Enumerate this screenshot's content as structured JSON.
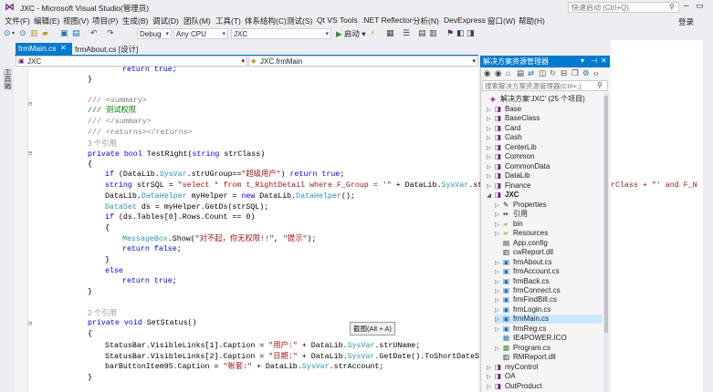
{
  "window": {
    "title": "JXC - Microsoft Visual Studio(管理员)",
    "quick_launch_placeholder": "快速启动 (Ctrl+Q)"
  },
  "menu": [
    "文件(F)",
    "编辑(E)",
    "视图(V)",
    "项目(P)",
    "生成(B)",
    "调试(D)",
    "团队(M)",
    "工具(T)",
    "体系结构(C)",
    "测试(S)",
    "Qt VS Tools",
    ".NET Reflector",
    "分析(N)",
    "DevExpress",
    "窗口(W)",
    "帮助(H)"
  ],
  "login": "登录",
  "toolbar": {
    "config": "Debug",
    "platform": "Any CPU",
    "project": "JXC",
    "start": "启动"
  },
  "tabs": [
    {
      "label": "frmMain.cs",
      "active": true
    },
    {
      "label": "frmAbout.cs [设计]",
      "active": false
    }
  ],
  "navbar": {
    "project": "JXC",
    "class": "JXC.frmMain"
  },
  "toolbox_label": "工具箱",
  "code": {
    "l1": "return true;",
    "l2": "}",
    "l3": "/// <summary>",
    "l4": "/// 测试权限",
    "l5": "/// </summary>",
    "l6": "/// <returns></returns>",
    "ref1": "3 个引用",
    "l7a": "private bool ",
    "l7b": "TestRight(",
    "l7c": "string",
    "l7d": " strClass)",
    "l8": "{",
    "l9a": "if",
    "l9b": " (DataLib.",
    "l9c": "SysVar",
    "l9d": ".strUGroup==",
    "l9e": "\"超级用户\"",
    "l9f": ") ",
    "l9g": "return true",
    "l9h": ";",
    "l10a": "string",
    "l10b": " strSQL = ",
    "l10c": "\"select * from t_RightDetail where F_Group = '\"",
    "l10d": " + DataLib.",
    "l10e": "SysVar",
    "l10f": ".strUGr",
    "l10g": "rClass + \"' and F_N",
    "l11a": "DataLib.",
    "l11b": "DataHelper",
    "l11c": " myHelper = ",
    "l11d": "new",
    "l11e": " DataLib.",
    "l11f": "DataHelper",
    "l11g": "();",
    "l12a": "DataSet",
    "l12b": " ds = myHelper.GetDs(strSQL);",
    "l13a": "if",
    "l13b": " (ds.Tables[0].Rows.Count == 0)",
    "l14": "{",
    "l15a": "MessageBox",
    "l15b": ".Show(",
    "l15c": "\"对不起，你无权限!!\"",
    "l15d": ", ",
    "l15e": "\"提示\"",
    "l15f": ");",
    "l16a": "return false",
    "l16b": ";",
    "l17": "}",
    "l18": "else",
    "l19a": "return true",
    "l19b": ";",
    "l20": "}",
    "ref2": "2 个引用",
    "l21a": "private void ",
    "l21b": "SetStatus()",
    "l22": "{",
    "l23a": "StatusBar.VisibleLinks[1].Caption = ",
    "l23b": "\"用户:\"",
    "l23c": " + DataLib.",
    "l23d": "SysVar",
    "l23e": ".strUName;",
    "l24a": "StatusBar.VisibleLinks[2].Caption = ",
    "l24b": "\"日期:\"",
    "l24c": " + DataLib.",
    "l24d": "SysVar",
    "l24e": ".GetDate().ToShortDateStrin",
    "l25a": "barButtonItem95.Caption = ",
    "l25b": "\"帐套:\"",
    "l25c": " + DataLib.",
    "l25d": "SysVar",
    "l25e": ".strAccount;",
    "l26": "}"
  },
  "tooltip": "截图(Alt + A)",
  "solution_explorer": {
    "title": "解决方案资源管理器",
    "search_placeholder": "搜索解决方案资源管理器(Ctrl+;)",
    "items": [
      {
        "label": "解决方案'JXC' (25 个项目)"
      },
      {
        "label": "Base"
      },
      {
        "label": "BaseClass"
      },
      {
        "label": "Card"
      },
      {
        "label": "Cash"
      },
      {
        "label": "CenterLib"
      },
      {
        "label": "Common"
      },
      {
        "label": "CommonData"
      },
      {
        "label": "DataLib"
      },
      {
        "label": "Finance"
      },
      {
        "label": "JXC"
      },
      {
        "label": "Properties"
      },
      {
        "label": "引用"
      },
      {
        "label": "bin"
      },
      {
        "label": "Resources"
      },
      {
        "label": "App.config"
      },
      {
        "label": "cwReport.dll"
      },
      {
        "label": "frmAbout.cs"
      },
      {
        "label": "frmAccount.cs"
      },
      {
        "label": "frmBack.cs"
      },
      {
        "label": "frmConnect.cs"
      },
      {
        "label": "frmFindBill.cs"
      },
      {
        "label": "frmLogin.cs"
      },
      {
        "label": "frmMain.cs"
      },
      {
        "label": "frmReg.cs"
      },
      {
        "label": "IE4POWER.ICO"
      },
      {
        "label": "Program.cs"
      },
      {
        "label": "RMReport.dll"
      },
      {
        "label": "myControl"
      },
      {
        "label": "OA"
      },
      {
        "label": "OutProduct"
      }
    ]
  },
  "colors": {
    "accent": "#007acc",
    "keyword": "#0000ff",
    "comment": "#008000",
    "string": "#a31515",
    "type": "#2b91af"
  }
}
